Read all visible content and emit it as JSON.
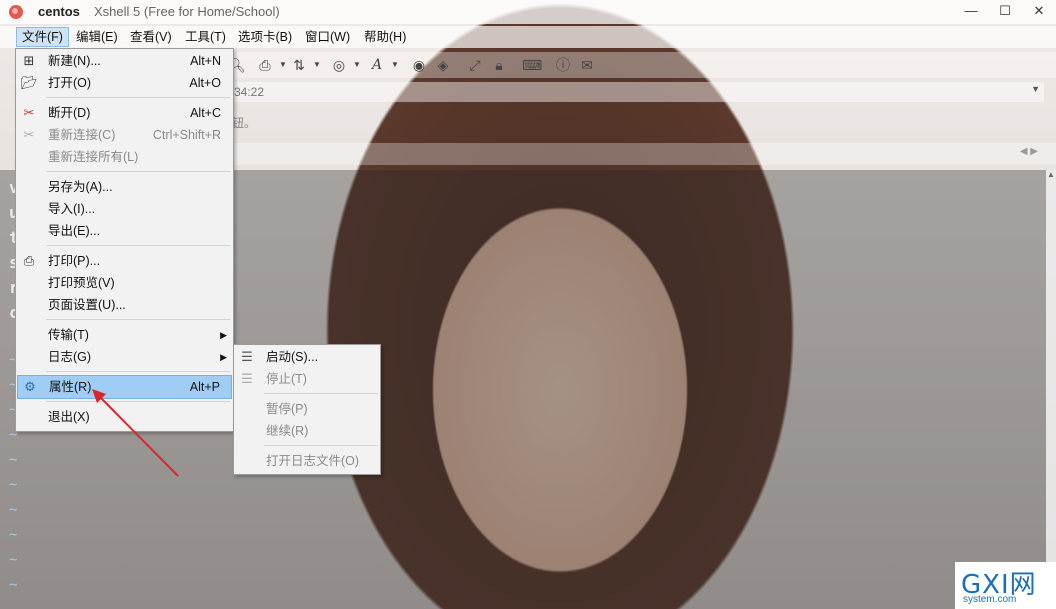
{
  "window": {
    "session": "centos",
    "app_title": "Xshell 5 (Free for Home/School)",
    "minimize": "—",
    "maximize": "☐",
    "close": "✕"
  },
  "menubar": [
    "文件(F)",
    "编辑(E)",
    "查看(V)",
    "工具(T)",
    "选项卡(B)",
    "窗口(W)",
    "帮助(H)"
  ],
  "address": {
    "text": "34:22"
  },
  "hint_text": "钮。",
  "terminal": {
    "letters": [
      "v",
      "u",
      "t",
      "s",
      "r",
      "c"
    ],
    "tilde": "~"
  },
  "file_menu": [
    {
      "label": "新建(N)...",
      "shortcut": "Alt+N",
      "icon": "new-session-icon"
    },
    {
      "label": "打开(O)",
      "shortcut": "Alt+O",
      "icon": "folder-open-icon"
    },
    {
      "label": "断开(D)",
      "shortcut": "Alt+C",
      "icon": "disconnect-icon"
    },
    {
      "label": "重新连接(C)",
      "shortcut": "Ctrl+Shift+R",
      "icon": "reconnect-icon",
      "disabled": true
    },
    {
      "label": "重新连接所有(L)",
      "shortcut": "",
      "disabled": true
    },
    {
      "label": "另存为(A)...",
      "shortcut": ""
    },
    {
      "label": "导入(I)...",
      "shortcut": ""
    },
    {
      "label": "导出(E)...",
      "shortcut": ""
    },
    {
      "label": "打印(P)...",
      "shortcut": "",
      "icon": "printer-icon"
    },
    {
      "label": "打印预览(V)",
      "shortcut": ""
    },
    {
      "label": "页面设置(U)...",
      "shortcut": ""
    },
    {
      "label": "传输(T)",
      "shortcut": "",
      "submenu": true
    },
    {
      "label": "日志(G)",
      "shortcut": "",
      "submenu": true
    },
    {
      "label": "属性(R)",
      "shortcut": "Alt+P",
      "icon": "properties-icon",
      "highlighted": true
    },
    {
      "label": "退出(X)",
      "shortcut": ""
    }
  ],
  "log_submenu": [
    {
      "label": "启动(S)...",
      "icon": "log-start-icon"
    },
    {
      "label": "停止(T)",
      "icon": "log-stop-icon",
      "disabled": true
    },
    {
      "label": "暂停(P)",
      "disabled": true
    },
    {
      "label": "继续(R)",
      "disabled": true
    },
    {
      "label": "打开日志文件(O)",
      "disabled": true
    }
  ],
  "watermark": {
    "logo": "GXI网",
    "url": "system.com"
  },
  "colors": {
    "highlight": "#9fcdf5",
    "annotation_arrow": "#d9262a",
    "watermark": "#1a6fb8"
  }
}
